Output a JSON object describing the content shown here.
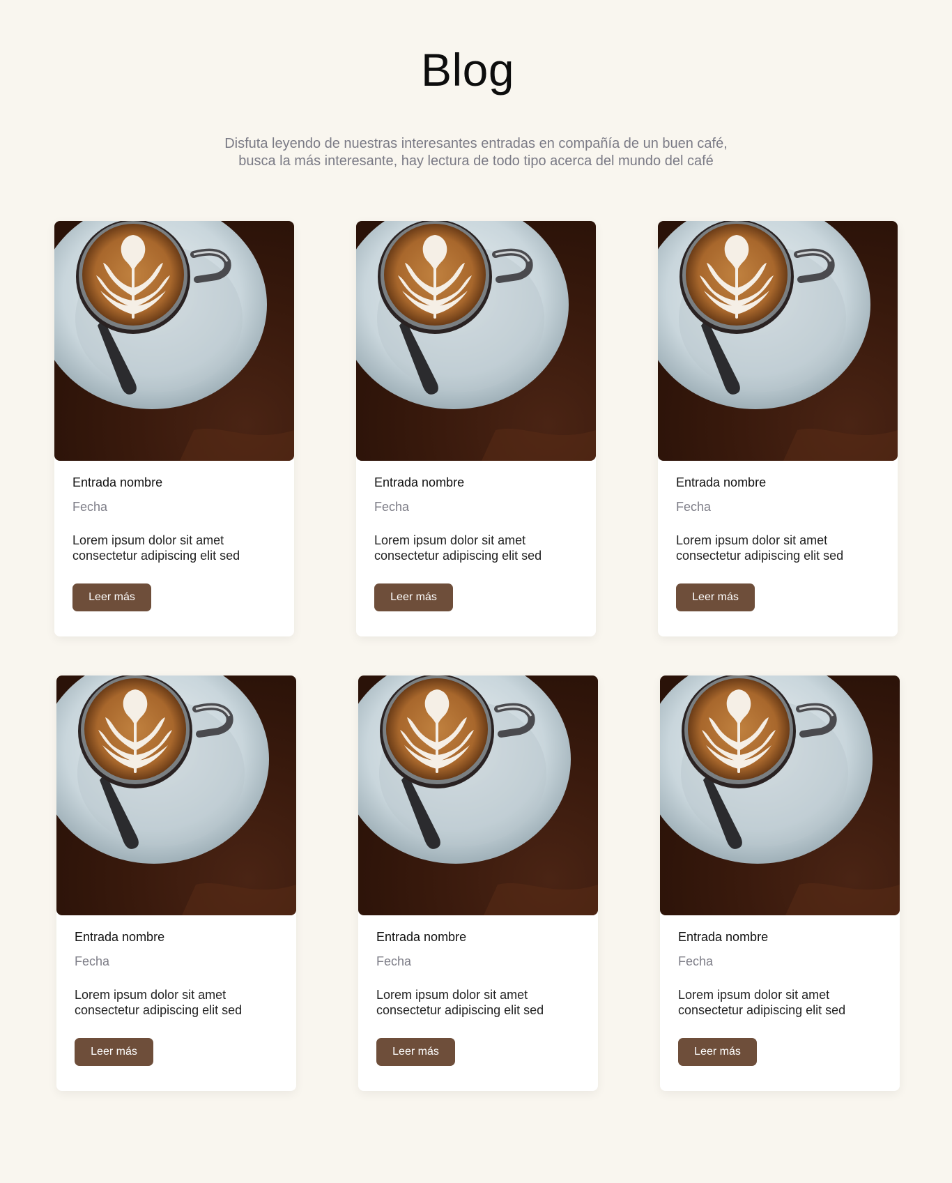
{
  "header": {
    "title": "Blog",
    "subtitle_lines": [
      "Disfuta leyendo de nuestras interesantes entradas en compañía de un buen café,",
      "busca la más interesante, hay lectura de todo tipo acerca del mundo del café"
    ]
  },
  "colors": {
    "background": "#f9f6ef",
    "button": "#6e4e3a",
    "card": "#ffffff"
  },
  "posts": [
    {
      "image": "latte-art-coffee-cup-image",
      "title": "Entrada nombre",
      "date": "Fecha",
      "excerpt_lines": [
        "Lorem ipsum dolor sit amet",
        "consectetur adipiscing elit sed"
      ],
      "button_label": "Leer más"
    },
    {
      "image": "latte-art-coffee-cup-image",
      "title": "Entrada nombre",
      "date": "Fecha",
      "excerpt_lines": [
        "Lorem ipsum dolor sit amet",
        "consectetur adipiscing elit sed"
      ],
      "button_label": "Leer más"
    },
    {
      "image": "latte-art-coffee-cup-image",
      "title": "Entrada nombre",
      "date": "Fecha",
      "excerpt_lines": [
        "Lorem ipsum dolor sit amet",
        "consectetur adipiscing elit sed"
      ],
      "button_label": "Leer más"
    },
    {
      "image": "latte-art-coffee-cup-image",
      "title": "Entrada nombre",
      "date": "Fecha",
      "excerpt_lines": [
        "Lorem ipsum dolor sit amet",
        "consectetur adipiscing elit sed"
      ],
      "button_label": "Leer más"
    },
    {
      "image": "latte-art-coffee-cup-image",
      "title": "Entrada nombre",
      "date": "Fecha",
      "excerpt_lines": [
        "Lorem ipsum dolor sit amet",
        "consectetur adipiscing elit sed"
      ],
      "button_label": "Leer más"
    },
    {
      "image": "latte-art-coffee-cup-image",
      "title": "Entrada nombre",
      "date": "Fecha",
      "excerpt_lines": [
        "Lorem ipsum dolor sit amet",
        "consectetur adipiscing elit sed"
      ],
      "button_label": "Leer más"
    }
  ]
}
